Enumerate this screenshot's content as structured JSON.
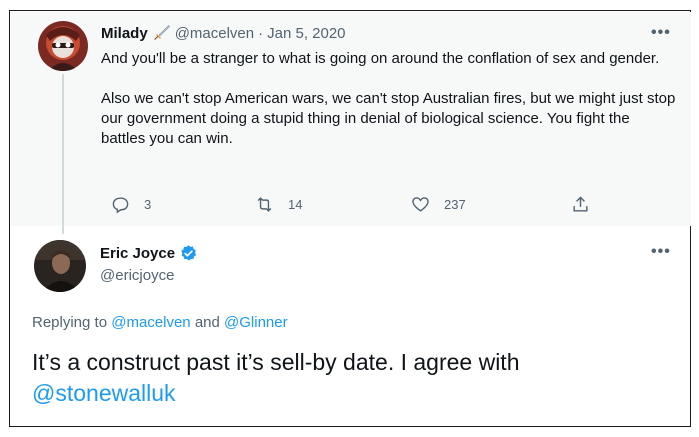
{
  "parent_tweet": {
    "display_name": "Milady",
    "emoji": "dagger-emoji",
    "handle": "@macelven",
    "separator": "·",
    "date": "Jan 5, 2020",
    "paragraphs": [
      "And you'll be a stranger to what is going on around the conflation of sex and gender.",
      "Also we can't stop American wars, we can't stop Australian fires, but we might just stop our government doing a stupid thing in denial of biological science. You fight the battles you can win."
    ],
    "reply_count": "3",
    "retweet_count": "14",
    "like_count": "237",
    "more_label": "•••"
  },
  "main_tweet": {
    "display_name": "Eric Joyce",
    "handle": "@ericjoyce",
    "verified": true,
    "more_label": "•••",
    "replying_prefix": "Replying to",
    "replying_user1": "@macelven",
    "replying_and": "and",
    "replying_user2": "@Glinner",
    "text": "It’s a construct past it’s sell-by date. I agree with",
    "mention": "@stonewalluk"
  },
  "colors": {
    "link": "#1d9bf0",
    "muted": "#536471",
    "text": "#0f1419",
    "parent_bg": "#f7f9f9"
  }
}
